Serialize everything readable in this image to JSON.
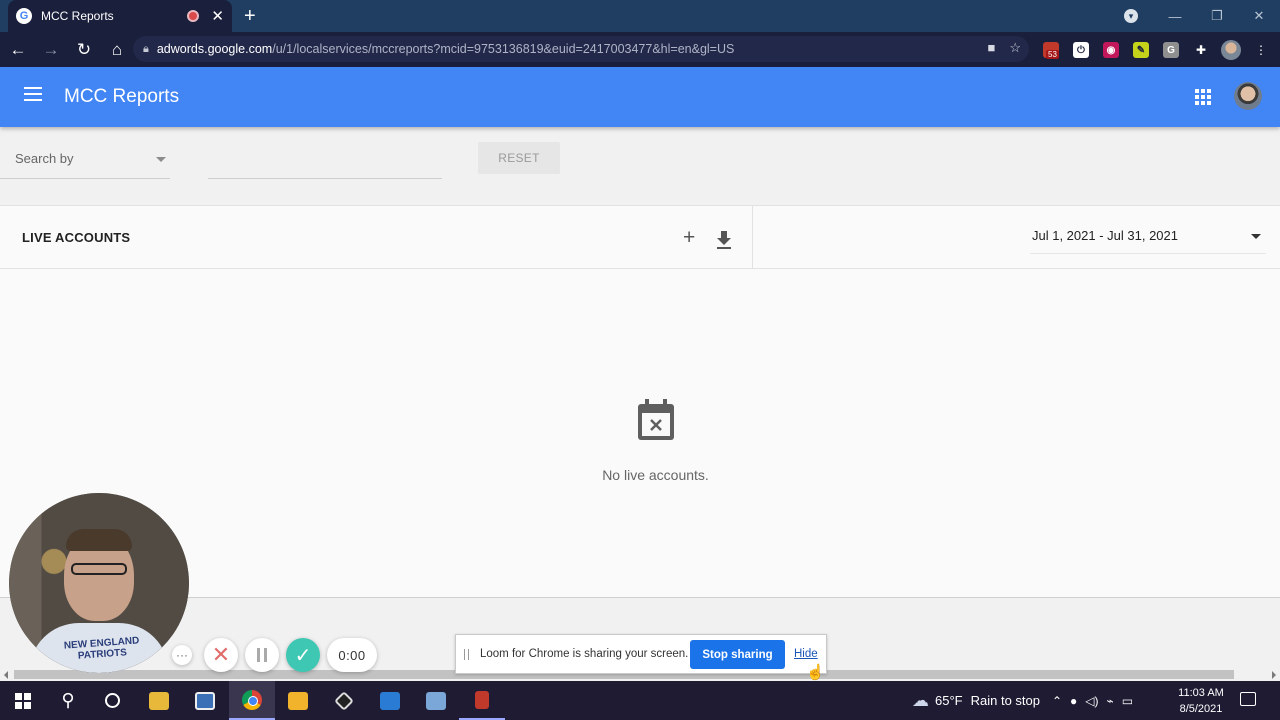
{
  "browser": {
    "tab_title": "MCC Reports",
    "tab_favicon": "G",
    "url_host": "adwords.google.com",
    "url_path": "/u/1/localservices/mccreports?mcid=9753136819&euid=2417003477&hl=en&gl=US",
    "extension_badge": "53",
    "colors": {
      "tabstrip": "#1f3e61",
      "toolbar": "#1a1f3c"
    }
  },
  "app": {
    "title": "MCC Reports",
    "accent": "#4285f4"
  },
  "filters": {
    "search_by_label": "Search by",
    "search_field_value": "",
    "reset_label": "RESET"
  },
  "card": {
    "title": "LIVE ACCOUNTS",
    "date_range": "Jul 1, 2021 - Jul 31, 2021",
    "empty_message": "No live accounts."
  },
  "loom": {
    "timer": "0:00",
    "share_message": "Loom for Chrome is sharing your screen.",
    "stop_label": "Stop sharing",
    "hide_label": "Hide",
    "shirt_text": "NEW ENGLAND\nPATRIOTS",
    "colors": {
      "done": "#3ec7b3",
      "cancel": "#e06c6c",
      "stop": "#1a73e8"
    }
  },
  "taskbar": {
    "weather_temp": "65°F",
    "weather_text": "Rain to stop",
    "time": "11:03 AM",
    "date": "8/5/2021"
  }
}
